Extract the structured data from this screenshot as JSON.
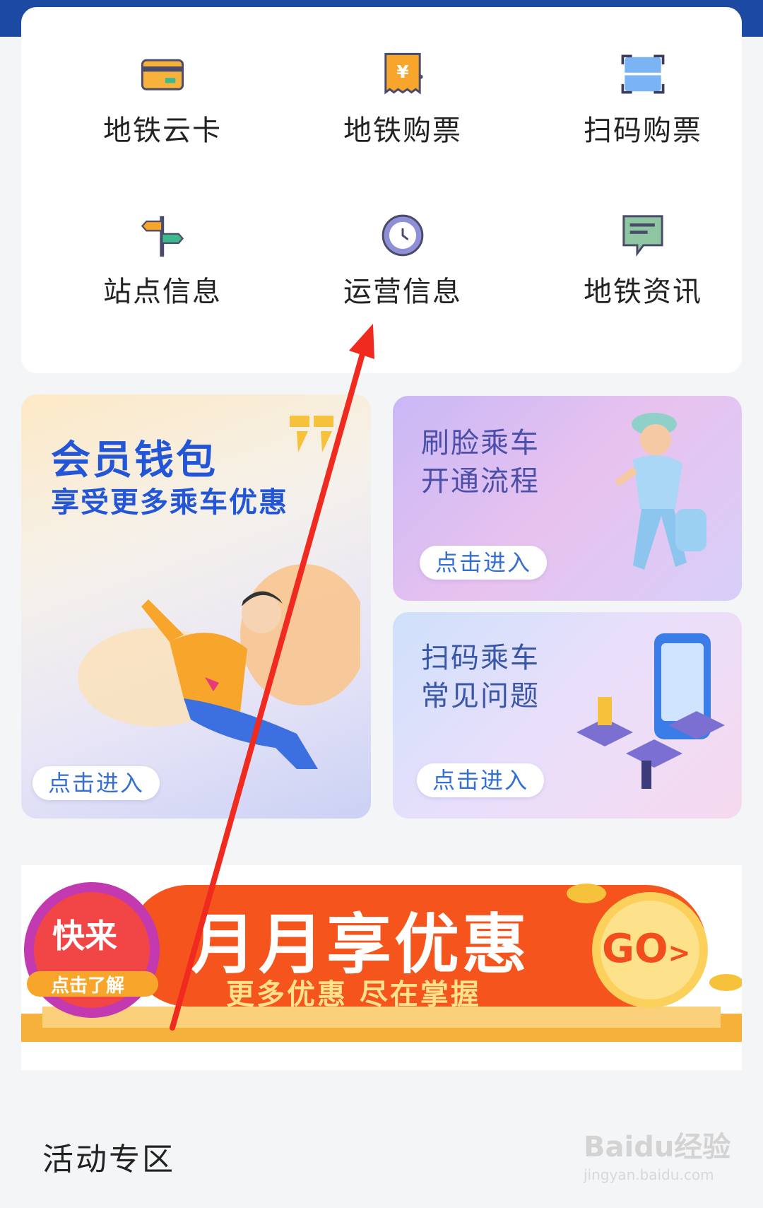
{
  "colors": {
    "top_bar": "#1c4aa3",
    "accent_blue": "#2356d6",
    "banner_orange": "#f5541d",
    "annotation_arrow": "#f02a1f"
  },
  "services": [
    {
      "label": "地铁云卡",
      "icon": "metro-card-icon"
    },
    {
      "label": "地铁购票",
      "icon": "ticket-yuan-icon"
    },
    {
      "label": "扫码购票",
      "icon": "scan-qr-icon"
    },
    {
      "label": "站点信息",
      "icon": "signpost-icon"
    },
    {
      "label": "运营信息",
      "icon": "clock-icon"
    },
    {
      "label": "地铁资讯",
      "icon": "news-chat-icon"
    }
  ],
  "promos": {
    "member": {
      "title": "会员钱包",
      "subtitle": "享受更多乘车优惠",
      "button": "点击进入"
    },
    "face": {
      "title_line1": "刷脸乘车",
      "title_line2": "开通流程",
      "button": "点击进入"
    },
    "faq": {
      "title_line1": "扫码乘车",
      "title_line2": "常见问题",
      "button": "点击进入"
    }
  },
  "banner": {
    "badge_top": "快来",
    "badge_bottom": "点击了解",
    "headline": "月月享优惠",
    "subline": "更多优惠 尽在掌握",
    "go": "GO",
    "go_chevron": ">"
  },
  "section": {
    "title": "活动专区"
  },
  "watermark": {
    "brand": "Baidu经验",
    "url": "jingyan.baidu.com"
  }
}
